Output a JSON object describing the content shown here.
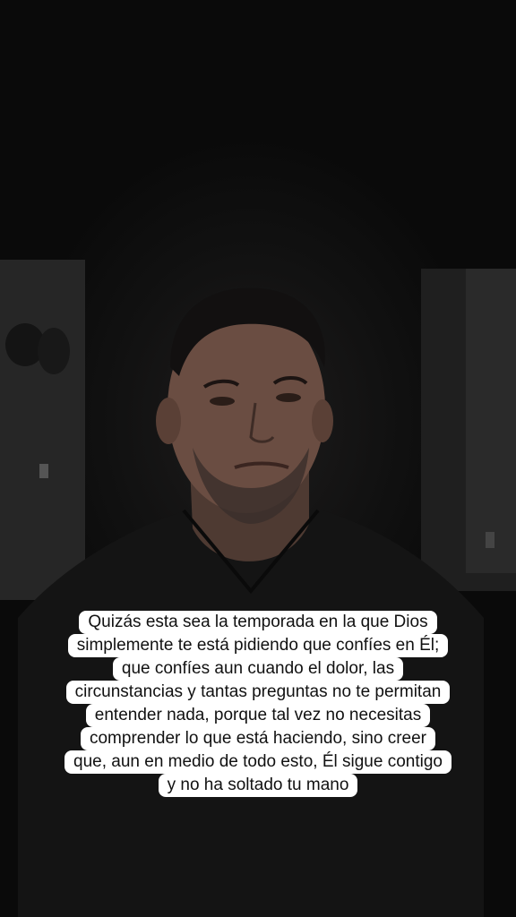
{
  "caption": {
    "lines": [
      "Quizás esta sea la temporada en la que Dios",
      "simplemente te está pidiendo que confíes en Él;",
      "que confíes aun cuando el dolor, las",
      "circunstancias y tantas preguntas no te permitan",
      "entender nada, porque tal vez no necesitas",
      "comprender lo que está haciendo, sino creer",
      "que, aun en medio de todo esto, Él sigue contigo",
      "y no ha soltado tu mano"
    ]
  },
  "colors": {
    "background": "#0c0c0c",
    "caption_bg": "#ffffff",
    "caption_text": "#111111"
  }
}
